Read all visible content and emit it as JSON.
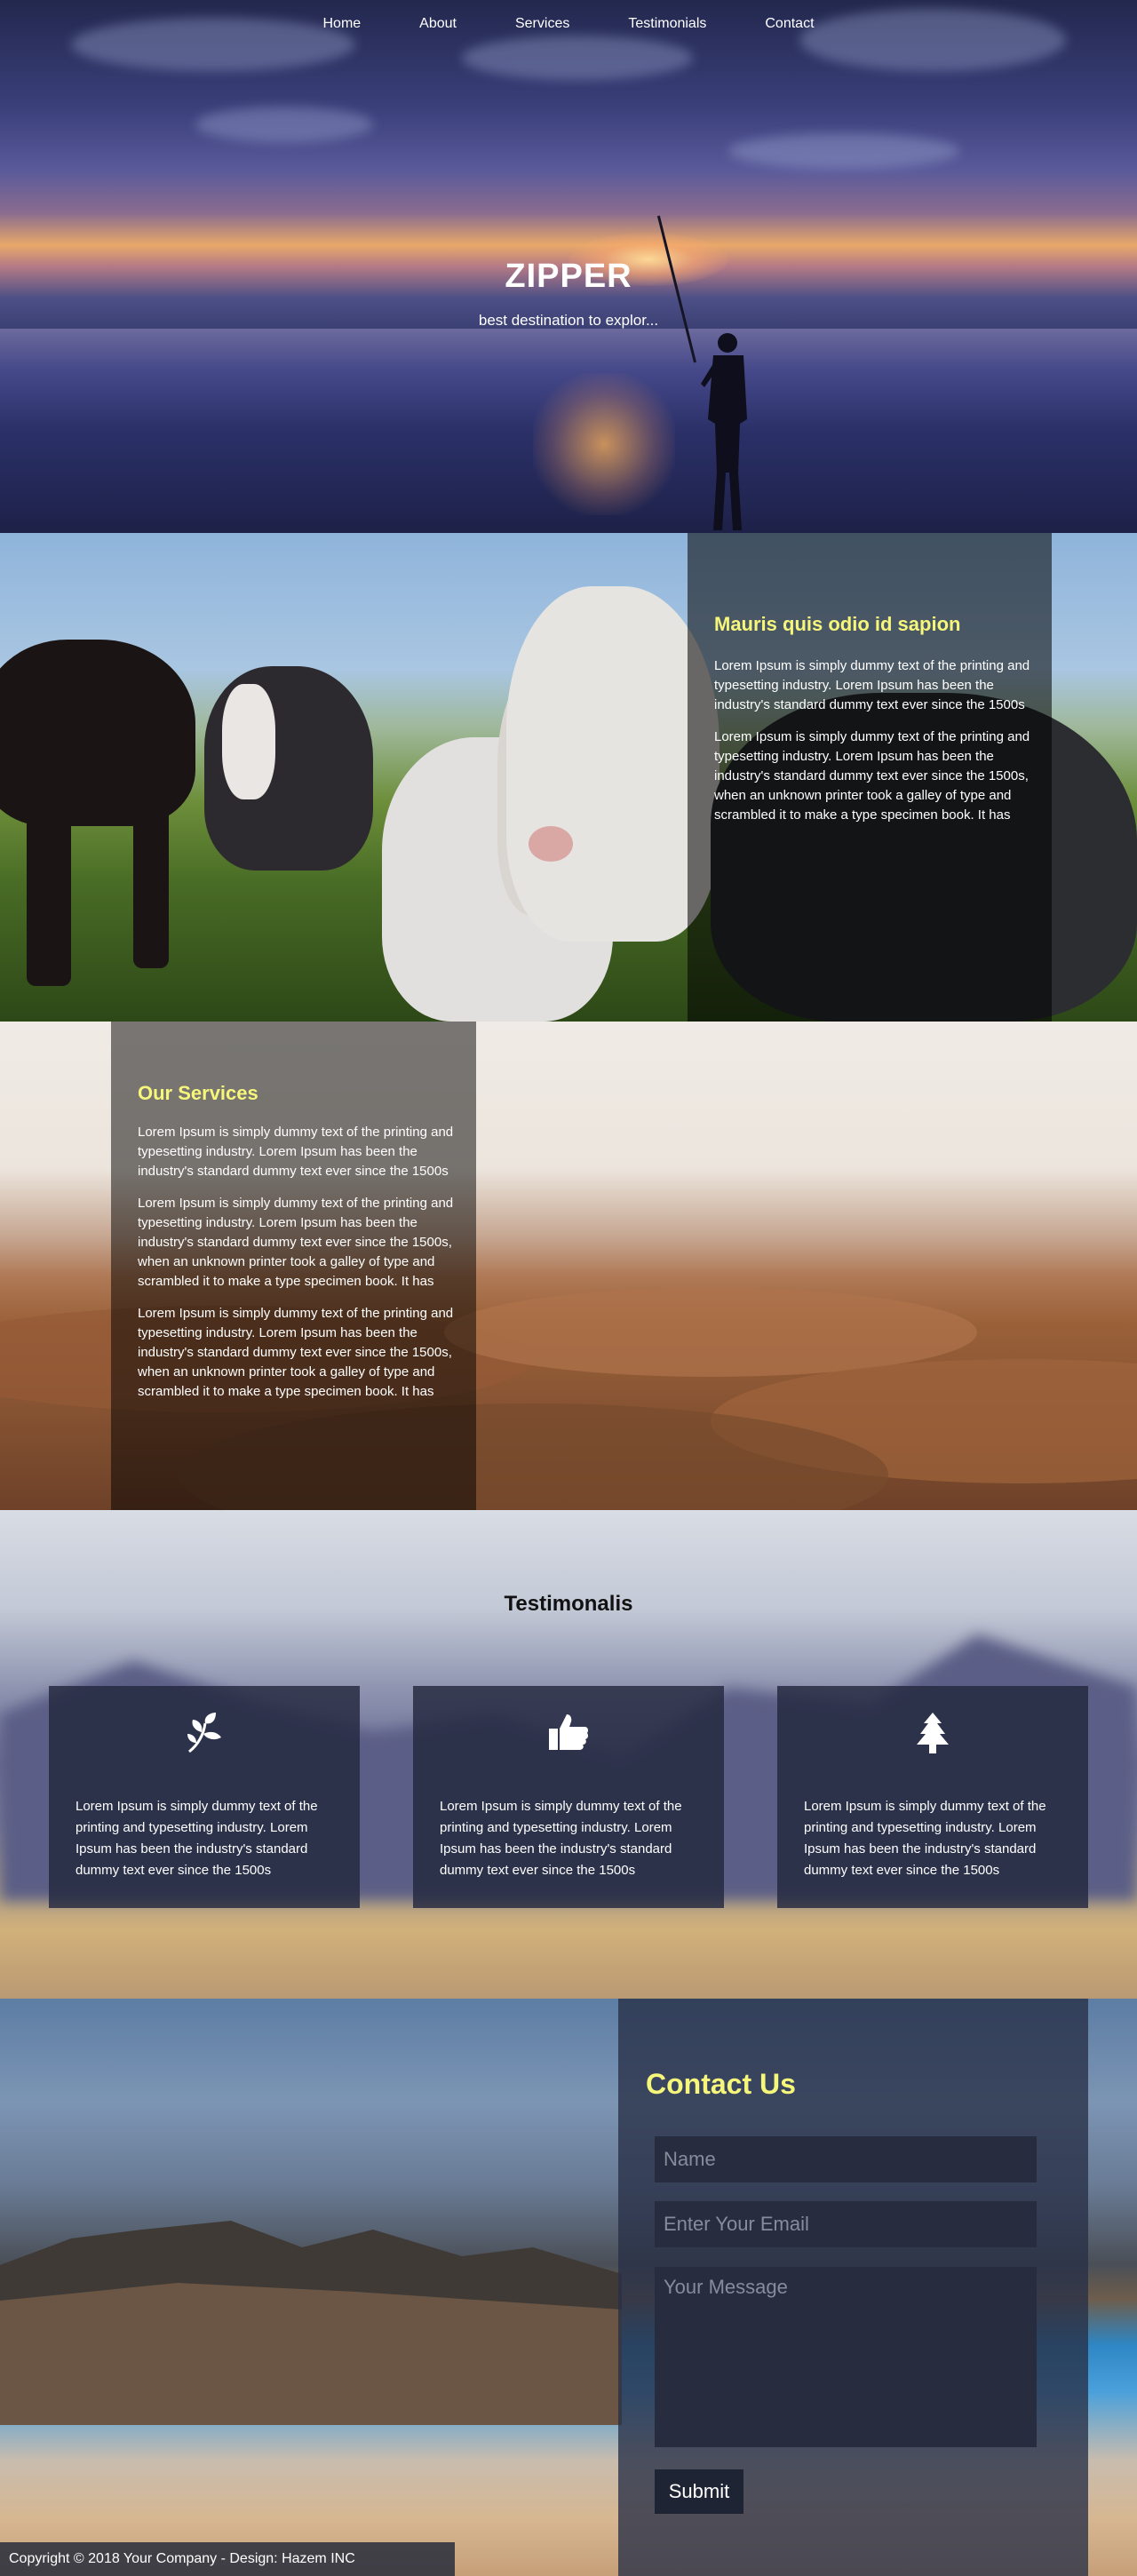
{
  "nav": {
    "items": [
      {
        "label": "Home"
      },
      {
        "label": "About"
      },
      {
        "label": "Services"
      },
      {
        "label": "Testimonials"
      },
      {
        "label": "Contact"
      }
    ]
  },
  "hero": {
    "title": "ZIPPER",
    "subtitle": "best destination to explor..."
  },
  "about": {
    "heading": "Mauris quis odio id sapion",
    "paragraphs": [
      "Lorem Ipsum is simply dummy text of the printing and typesetting industry. Lorem Ipsum has been the industry's standard dummy text ever since the 1500s",
      "Lorem Ipsum is simply dummy text of the printing and typesetting industry. Lorem Ipsum has been the industry's standard dummy text ever since the 1500s, when an unknown printer took a galley of type and scrambled it to make a type specimen book. It has"
    ]
  },
  "services": {
    "heading": "Our Services",
    "paragraphs": [
      "Lorem Ipsum is simply dummy text of the printing and typesetting industry. Lorem Ipsum has been the industry's standard dummy text ever since the 1500s",
      "Lorem Ipsum is simply dummy text of the printing and typesetting industry. Lorem Ipsum has been the industry's standard dummy text ever since the 1500s, when an unknown printer took a galley of type and scrambled it to make a type specimen book. It has",
      "Lorem Ipsum is simply dummy text of the printing and typesetting industry. Lorem Ipsum has been the industry's standard dummy text ever since the 1500s, when an unknown printer took a galley of type and scrambled it to make a type specimen book. It has"
    ]
  },
  "testimonials": {
    "title": "Testimonalis",
    "cards": [
      {
        "icon": "leaf-icon",
        "text": "Lorem Ipsum is simply dummy text of the printing and typesetting industry. Lorem Ipsum has been the industry's standard dummy text ever since the 1500s"
      },
      {
        "icon": "thumbs-up-icon",
        "text": "Lorem Ipsum is simply dummy text of the printing and typesetting industry. Lorem Ipsum has been the industry's standard dummy text ever since the 1500s"
      },
      {
        "icon": "tree-icon",
        "text": "Lorem Ipsum is simply dummy text of the printing and typesetting industry. Lorem Ipsum has been the industry's standard dummy text ever since the 1500s"
      }
    ]
  },
  "contact": {
    "title": "Contact Us",
    "name_placeholder": "Name",
    "email_placeholder": "Enter Your Email",
    "message_placeholder": "Your Message",
    "submit_label": "Submit"
  },
  "footer": {
    "text": "Copyright © 2018 Your Company - Design: Hazem INC"
  },
  "colors": {
    "accent_heading": "#f6f67a",
    "box_overlay": "#000000",
    "card_bg": "#23283e"
  }
}
